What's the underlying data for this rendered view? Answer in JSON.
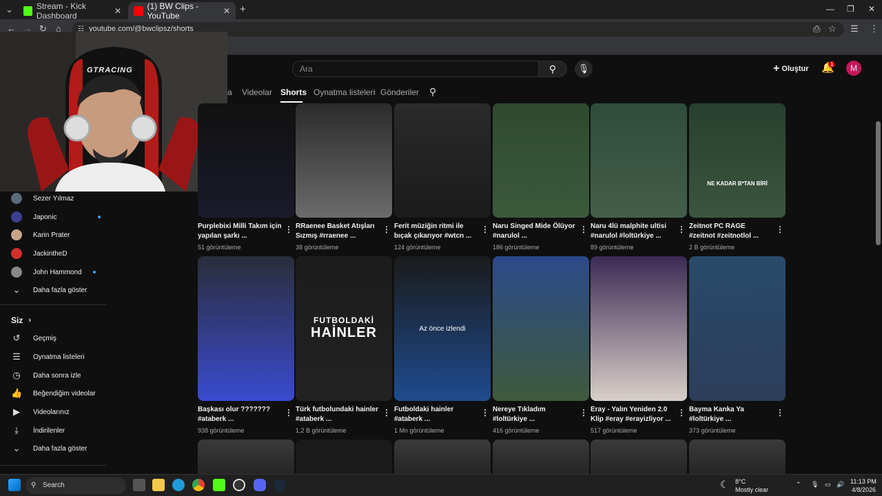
{
  "browser": {
    "tabs": [
      {
        "title": "Stream - Kick Dashboard",
        "active": false
      },
      {
        "title": "(1) BW Clips - YouTube",
        "active": true
      }
    ],
    "url": "youtube.com/@bwclipsz/shorts"
  },
  "youtube": {
    "search_placeholder": "Ara",
    "create_label": "Oluştur",
    "notif_count": "1",
    "avatar_letter": "M",
    "channel_tabs": [
      {
        "label": "a"
      },
      {
        "label": "Videolar"
      },
      {
        "label": "Shorts",
        "active": true
      },
      {
        "label": "Oynatma listeleri"
      },
      {
        "label": "Gönderiler"
      }
    ]
  },
  "sidebar": {
    "subscriptions": [
      {
        "name": "Sezer Yılmaz",
        "color": "#5a6b7c",
        "dot": false
      },
      {
        "name": "Japonic",
        "color": "#3a3f8f",
        "dot": true
      },
      {
        "name": "Karin Prater",
        "color": "#c8a58a",
        "dot": false
      },
      {
        "name": "JackintheD",
        "color": "#d32f2f",
        "dot": false
      },
      {
        "name": "John Hammond",
        "color": "#888888",
        "dot": true
      }
    ],
    "show_more": "Daha fazla göster",
    "you_header": "Siz",
    "you_items": [
      {
        "label": "Geçmiş",
        "icon": "history-icon"
      },
      {
        "label": "Oynatma listeleri",
        "icon": "playlist-icon"
      },
      {
        "label": "Daha sonra izle",
        "icon": "clock-icon"
      },
      {
        "label": "Beğendiğim videolar",
        "icon": "thumbs-up-icon"
      },
      {
        "label": "Videolarınız",
        "icon": "video-icon"
      },
      {
        "label": "İndirilenler",
        "icon": "download-icon"
      }
    ],
    "show_more_2": "Daha fazla göster"
  },
  "shorts": [
    {
      "title": "Purplebixi Milli Takım için yapılan şarkı ...",
      "views": "51 görüntüleme",
      "thumb_top": "#111111",
      "thumb_bot": "#1a1a2a"
    },
    {
      "title": "RRaenee Basket Atışları Sızmış #rraenee ...",
      "views": "38 görüntüleme",
      "thumb_top": "#2b2b2b",
      "thumb_bot": "#6b6b6b"
    },
    {
      "title": "Ferit müziğin ritmi ile bıçak çıkarıyor #wtcn ...",
      "views": "124 görüntüleme",
      "thumb_top": "#2a2a2a",
      "thumb_bot": "#1b1b1b"
    },
    {
      "title": "Naru Singed Mide Ölüyor #narulol ...",
      "views": "186 görüntüleme",
      "thumb_top": "#2e4a2e",
      "thumb_bot": "#3b5a3a"
    },
    {
      "title": "Naru 4lü malphite ultisi #narulol #loltürkiye ...",
      "views": "89 görüntüleme",
      "thumb_top": "#2f4b3b",
      "thumb_bot": "#435f4a"
    },
    {
      "title": "Zeitnot PC RAGE #zeitnot #zeitnotlol ...",
      "views": "2 B görüntüleme",
      "thumb_top": "#27402f",
      "thumb_bot": "#3b5540"
    },
    {
      "title": "Başkası olur ??????? #ataberk ...",
      "views": "938 görüntüleme",
      "thumb_top": "#2a2d3a",
      "thumb_bot": "#3a4bd0"
    },
    {
      "title": "Türk futbolundaki hainler #ataberk ...",
      "views": "1,2 B görüntüleme",
      "thumb_top": "#1c1c1c",
      "thumb_bot": "#222222"
    },
    {
      "title": "Futboldaki hainler #ataberk ...",
      "views": "1 Mn görüntüleme",
      "thumb_top": "#1b1b1b",
      "thumb_bot": "#1e4b8f"
    },
    {
      "title": "Nereye Tıkladım #loltürkiye ...",
      "views": "416 görüntüleme",
      "thumb_top": "#2c4a8a",
      "thumb_bot": "#3e5a3c"
    },
    {
      "title": "Eray - Yalın Yeniden 2.0 Klip #eray #erayizliyor ...",
      "views": "517 görüntüleme",
      "thumb_top": "#3b2a55",
      "thumb_bot": "#d8d0c8"
    },
    {
      "title": "Bayma Kanka Ya #loltürkiye ...",
      "views": "373 görüntüleme",
      "thumb_top": "#2a4a6a",
      "thumb_bot": "#2b3e5a"
    }
  ],
  "overlays": {
    "ne_kadar": "NE KADAR B*TAN BİRİ",
    "az_once": "Az önce izlendi",
    "futboldaki": "FUTBOLDAKİ",
    "hainler": "HAİNLER"
  },
  "webcam": {
    "chair_brand": "GTRACING"
  },
  "taskbar": {
    "search_label": "Search",
    "weather_temp": "8°C",
    "weather_desc": "Mostly clear",
    "time": "11:13 PM",
    "date": "4/8/2026"
  }
}
